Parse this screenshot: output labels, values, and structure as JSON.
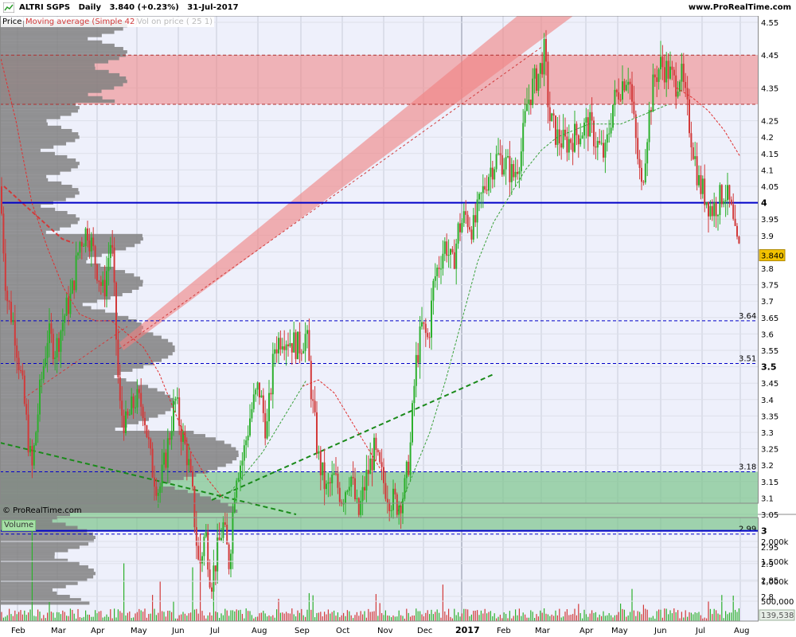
{
  "header": {
    "symbol": "ALTRI SGPS",
    "period": "Daily",
    "last": "3.840 (+0.23%)",
    "date": "31-Jul-2017",
    "site": "www.ProRealTime.com"
  },
  "legend": {
    "price": "Price",
    "ma": "Moving average (Simple 42)",
    "vop": "Vol on price ( 25 1)"
  },
  "copyright": "© ProRealTime.com",
  "volume_label": "Volume",
  "colors": {
    "up": "#2db02d",
    "down": "#d23a3a",
    "ma": "#e03030",
    "ma2": "#3aa03a",
    "channel": "#f08080",
    "support_zone": "#7cc48c",
    "blue_line": "#0000c8",
    "profile": "#808080",
    "bg": "#eef0fb"
  },
  "chart_data": [
    {
      "type": "candlestick",
      "title": "ALTRI SGPS Daily",
      "xlabel": "",
      "ylabel": "",
      "x_ticks": [
        "Feb",
        "Mar",
        "Apr",
        "May",
        "Jun",
        "Jul",
        "Aug",
        "Sep",
        "Oct",
        "Nov",
        "Dec",
        "2017",
        "Feb",
        "Mar",
        "Apr",
        "May",
        "Jun",
        "Jul",
        "Aug"
      ],
      "y_ticks": [
        "4.55",
        "4.45",
        "4.35",
        "4.25",
        "4.2",
        "4.15",
        "4.1",
        "4.05",
        "4",
        "3.95",
        "3.9",
        "3.85",
        "3.8",
        "3.75",
        "3.7",
        "3.65",
        "3.6",
        "3.55",
        "3.5",
        "3.45",
        "3.4",
        "3.35",
        "3.3",
        "3.25",
        "3.2",
        "3.15",
        "3.1",
        "3.05",
        "3",
        "2.95",
        "2.9",
        "2.85",
        "2.8"
      ],
      "ylim": [
        2.76,
        4.58
      ],
      "last_price": "3.840",
      "horizontal_levels": [
        {
          "label": "3.64",
          "value": 3.64
        },
        {
          "label": "3.51",
          "value": 3.51
        },
        {
          "label": "3.18",
          "value": 3.18
        },
        {
          "label": "2.99",
          "value": 2.99
        }
      ],
      "bold_levels": [
        4.0,
        3.0
      ],
      "resistance_zone": [
        4.3,
        4.45
      ],
      "support_zone": [
        3.0,
        3.18
      ],
      "price_path": [
        [
          0,
          4.05
        ],
        [
          8,
          3.72
        ],
        [
          18,
          3.62
        ],
        [
          30,
          3.4
        ],
        [
          40,
          3.18
        ],
        [
          50,
          3.42
        ],
        [
          60,
          3.6
        ],
        [
          70,
          3.55
        ],
        [
          80,
          3.65
        ],
        [
          90,
          3.72
        ],
        [
          100,
          3.88
        ],
        [
          110,
          3.92
        ],
        [
          120,
          3.82
        ],
        [
          130,
          3.72
        ],
        [
          140,
          3.9
        ],
        [
          150,
          3.38
        ],
        [
          158,
          3.32
        ],
        [
          170,
          3.4
        ],
        [
          180,
          3.38
        ],
        [
          190,
          3.2
        ],
        [
          200,
          3.12
        ],
        [
          210,
          3.25
        ],
        [
          220,
          3.4
        ],
        [
          228,
          3.3
        ],
        [
          236,
          3.22
        ],
        [
          242,
          3.1
        ],
        [
          250,
          2.88
        ],
        [
          258,
          3.0
        ],
        [
          265,
          2.84
        ],
        [
          272,
          2.92
        ],
        [
          280,
          3.02
        ],
        [
          288,
          2.9
        ],
        [
          296,
          3.18
        ],
        [
          305,
          3.22
        ],
        [
          315,
          3.36
        ],
        [
          325,
          3.44
        ],
        [
          335,
          3.3
        ],
        [
          345,
          3.56
        ],
        [
          355,
          3.6
        ],
        [
          365,
          3.58
        ],
        [
          375,
          3.56
        ],
        [
          385,
          3.6
        ],
        [
          392,
          3.4
        ],
        [
          400,
          3.22
        ],
        [
          410,
          3.12
        ],
        [
          420,
          3.16
        ],
        [
          430,
          3.1
        ],
        [
          440,
          3.18
        ],
        [
          450,
          3.04
        ],
        [
          460,
          3.16
        ],
        [
          470,
          3.24
        ],
        [
          480,
          3.16
        ],
        [
          490,
          3.1
        ],
        [
          500,
          3.08
        ],
        [
          508,
          3.12
        ],
        [
          515,
          3.24
        ],
        [
          522,
          3.5
        ],
        [
          530,
          3.62
        ],
        [
          538,
          3.58
        ],
        [
          545,
          3.76
        ],
        [
          552,
          3.82
        ],
        [
          560,
          3.88
        ],
        [
          568,
          3.8
        ],
        [
          576,
          3.92
        ],
        [
          585,
          3.96
        ],
        [
          595,
          3.92
        ],
        [
          605,
          4.02
        ],
        [
          615,
          4.1
        ],
        [
          625,
          4.14
        ],
        [
          635,
          4.12
        ],
        [
          645,
          4.08
        ],
        [
          655,
          4.16
        ],
        [
          662,
          4.3
        ],
        [
          670,
          4.36
        ],
        [
          678,
          4.4
        ],
        [
          684,
          4.46
        ],
        [
          690,
          4.26
        ],
        [
          700,
          4.2
        ],
        [
          710,
          4.18
        ],
        [
          720,
          4.2
        ],
        [
          730,
          4.22
        ],
        [
          740,
          4.24
        ],
        [
          750,
          4.18
        ],
        [
          760,
          4.14
        ],
        [
          770,
          4.3
        ],
        [
          780,
          4.36
        ],
        [
          790,
          4.4
        ],
        [
          798,
          4.2
        ],
        [
          806,
          4.04
        ],
        [
          814,
          4.24
        ],
        [
          822,
          4.38
        ],
        [
          830,
          4.42
        ],
        [
          840,
          4.4
        ],
        [
          848,
          4.36
        ],
        [
          855,
          4.4
        ],
        [
          862,
          4.3
        ],
        [
          870,
          4.18
        ],
        [
          878,
          4.06
        ],
        [
          886,
          4.02
        ],
        [
          894,
          3.98
        ],
        [
          902,
          4.0
        ],
        [
          910,
          4.04
        ],
        [
          918,
          3.98
        ],
        [
          924,
          3.88
        ],
        [
          930,
          3.84
        ]
      ],
      "ma_red": [
        [
          0,
          4.45
        ],
        [
          20,
          4.25
        ],
        [
          40,
          4.0
        ],
        [
          60,
          3.86
        ],
        [
          80,
          3.74
        ],
        [
          100,
          3.66
        ],
        [
          120,
          3.64
        ],
        [
          140,
          3.64
        ],
        [
          160,
          3.6
        ],
        [
          180,
          3.56
        ],
        [
          200,
          3.48
        ],
        [
          220,
          3.36
        ],
        [
          240,
          3.24
        ],
        [
          260,
          3.16
        ],
        [
          280,
          3.1
        ]
      ],
      "ma_red2": [
        [
          380,
          3.44
        ],
        [
          400,
          3.46
        ],
        [
          420,
          3.42
        ],
        [
          440,
          3.34
        ],
        [
          460,
          3.26
        ],
        [
          480,
          3.18
        ]
      ],
      "ma_red3": [
        [
          850,
          4.35
        ],
        [
          870,
          4.32
        ],
        [
          890,
          4.28
        ],
        [
          910,
          4.22
        ],
        [
          930,
          4.14
        ]
      ],
      "ma_green": [
        [
          290,
          3.12
        ],
        [
          310,
          3.18
        ],
        [
          330,
          3.24
        ],
        [
          350,
          3.32
        ],
        [
          370,
          3.4
        ],
        [
          385,
          3.46
        ]
      ],
      "ma_green2": [
        [
          500,
          3.06
        ],
        [
          520,
          3.18
        ],
        [
          540,
          3.3
        ],
        [
          560,
          3.46
        ],
        [
          580,
          3.64
        ],
        [
          600,
          3.82
        ],
        [
          620,
          3.94
        ],
        [
          640,
          4.02
        ],
        [
          660,
          4.1
        ],
        [
          680,
          4.16
        ],
        [
          700,
          4.2
        ],
        [
          720,
          4.22
        ],
        [
          740,
          4.24
        ],
        [
          760,
          4.24
        ],
        [
          780,
          4.24
        ],
        [
          800,
          4.26
        ],
        [
          820,
          4.28
        ],
        [
          840,
          4.3
        ]
      ]
    },
    {
      "type": "bar",
      "title": "Volume",
      "y_ticks": [
        "2,000k",
        "1,500k",
        "1,000k",
        "500,000"
      ],
      "ylim": [
        0,
        2400000
      ],
      "last_volume": "139,538"
    }
  ]
}
